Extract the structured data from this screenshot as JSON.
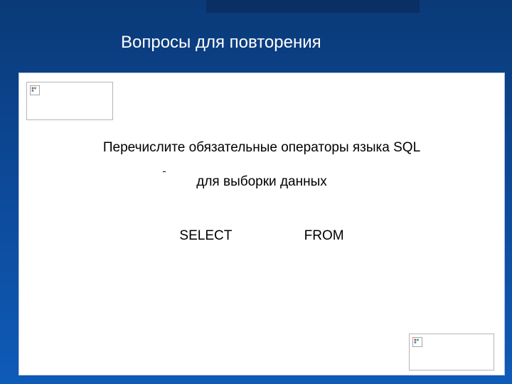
{
  "slide": {
    "title": "Вопросы для повторения",
    "question": {
      "line1": "Перечислите обязательные операторы языка SQL",
      "line2": "для выборки данных"
    },
    "answers": {
      "first": "SELECT",
      "second": "FROM"
    }
  }
}
